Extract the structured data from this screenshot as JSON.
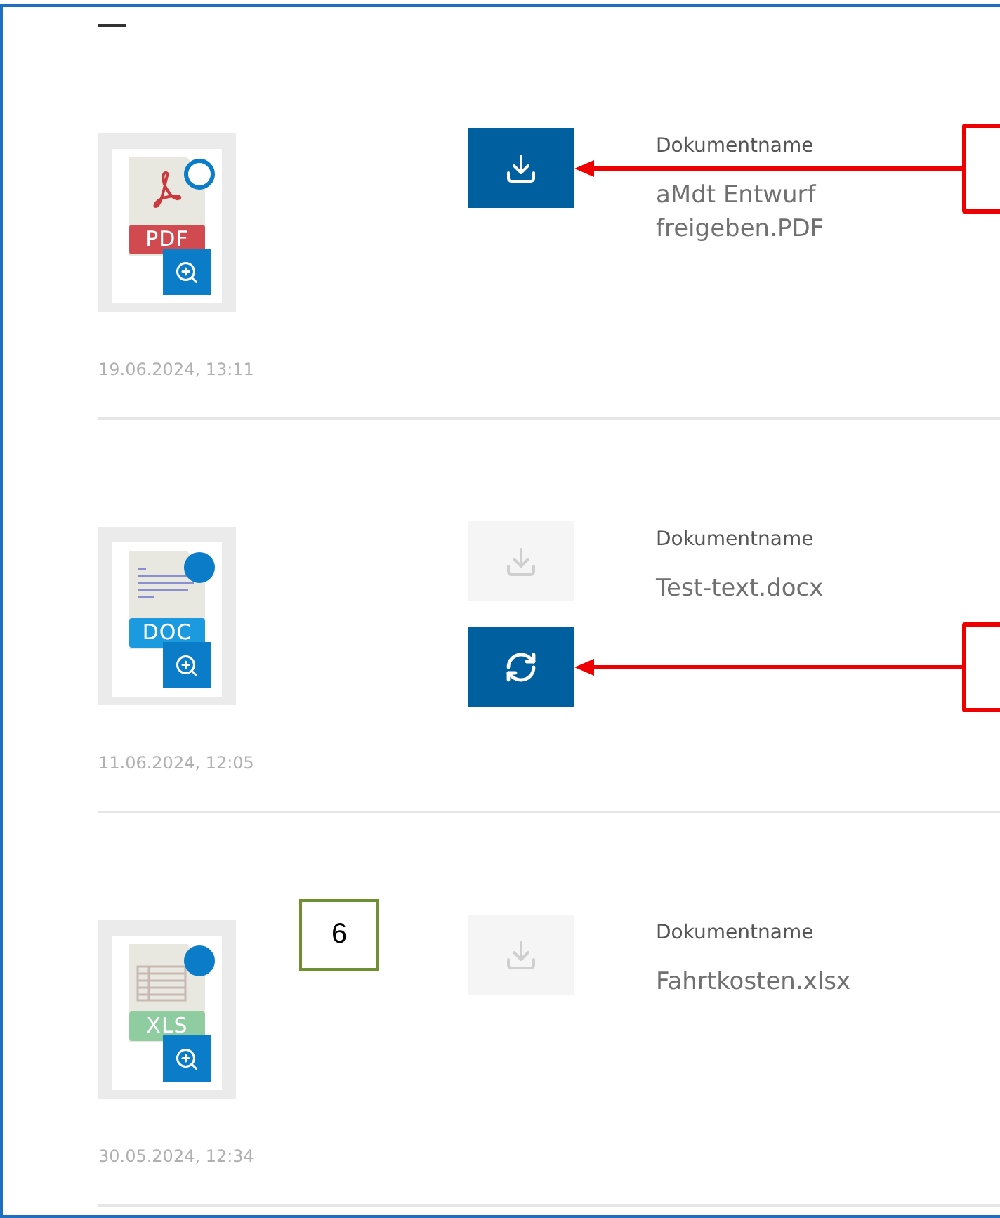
{
  "documents": [
    {
      "kind": "pdf",
      "file_label": "PDF",
      "selected": false,
      "date": "19.06.2024, 13:11",
      "field_label": "Dokumentname",
      "name": "aMdt Entwurf freigeben.PDF",
      "actions": [
        {
          "kind": "download",
          "disabled": false,
          "callout": {
            "kind": "arrow-box"
          }
        }
      ]
    },
    {
      "kind": "doc",
      "file_label": "DOC",
      "selected": true,
      "date": "11.06.2024, 12:05",
      "field_label": "Dokumentname",
      "name": "Test-text.docx",
      "actions": [
        {
          "kind": "download",
          "disabled": true
        },
        {
          "kind": "sync",
          "disabled": false,
          "callout": {
            "kind": "arrow-box"
          }
        }
      ]
    },
    {
      "kind": "xls",
      "file_label": "XLS",
      "selected": true,
      "date": "30.05.2024, 12:34",
      "field_label": "Dokumentname",
      "name": "Fahrtkosten.xlsx",
      "actions": [
        {
          "kind": "download",
          "disabled": true
        }
      ],
      "tag": "6"
    }
  ]
}
